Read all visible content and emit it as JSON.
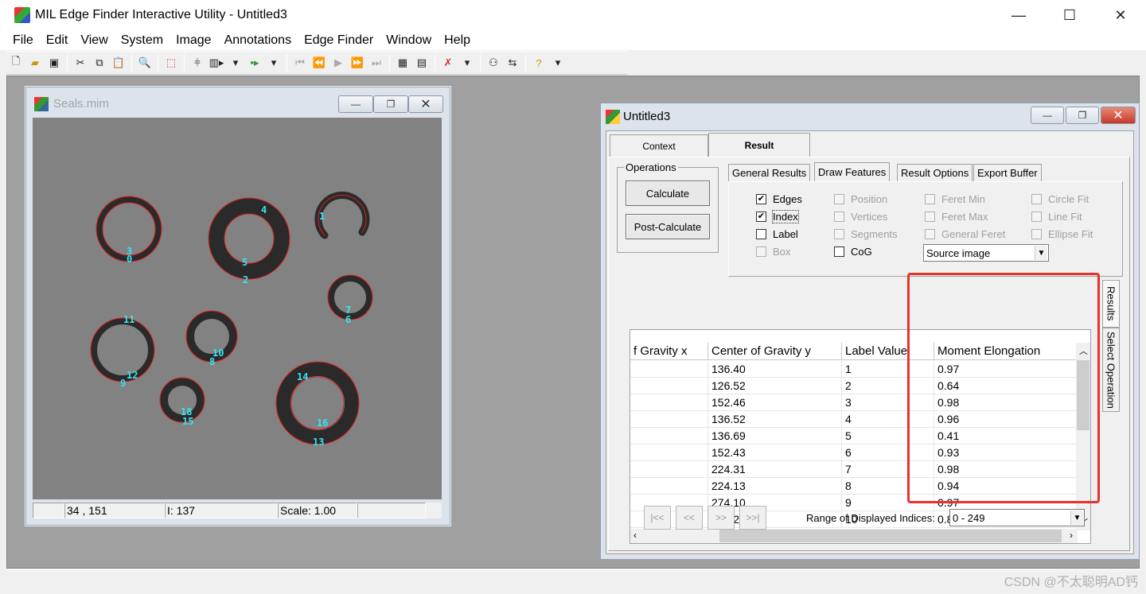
{
  "app": {
    "title": "MIL Edge Finder Interactive Utility - Untitled3"
  },
  "window_controls": {
    "minimize": "—",
    "maximize": "☐",
    "close": "✕"
  },
  "menu": [
    {
      "label": "File"
    },
    {
      "label": "Edit"
    },
    {
      "label": "View"
    },
    {
      "label": "System"
    },
    {
      "label": "Image"
    },
    {
      "label": "Annotations"
    },
    {
      "label": "Edge Finder"
    },
    {
      "label": "Window"
    },
    {
      "label": "Help"
    }
  ],
  "toolbar_icons": [
    "new-icon",
    "open-icon",
    "save-icon",
    "cut-icon",
    "copy-icon",
    "paste-icon",
    "zoom-icon",
    "select-rect-icon",
    "calibrate-icon",
    "step-icon",
    "run-icon",
    "first-icon",
    "prev-icon",
    "play-icon",
    "next-icon",
    "last-icon",
    "grid-icon",
    "properties-icon",
    "draw-icon",
    "result-icon",
    "export-icon",
    "help-icon"
  ],
  "seals_window": {
    "title": "Seals.mim",
    "status": {
      "coords": "34 , 151",
      "intensity": "I: 137",
      "scale": "Scale: 1.00"
    },
    "labels": [
      {
        "text": "3"
      },
      {
        "text": "0"
      },
      {
        "text": "4"
      },
      {
        "text": "1"
      },
      {
        "text": "5"
      },
      {
        "text": "2"
      },
      {
        "text": "7"
      },
      {
        "text": "6"
      },
      {
        "text": "11"
      },
      {
        "text": "10"
      },
      {
        "text": "8"
      },
      {
        "text": "12"
      },
      {
        "text": "9"
      },
      {
        "text": "14"
      },
      {
        "text": "18"
      },
      {
        "text": "15"
      },
      {
        "text": "16"
      },
      {
        "text": "13"
      }
    ]
  },
  "untitled_window": {
    "title": "Untitled3",
    "tabs": [
      {
        "label": "Context"
      },
      {
        "label": "Result"
      }
    ],
    "operations": {
      "label": "Operations",
      "calculate": "Calculate",
      "post_calculate": "Post-Calculate"
    },
    "inner_tabs": [
      {
        "label": "General Results"
      },
      {
        "label": "Draw Features"
      },
      {
        "label": "Result Options"
      },
      {
        "label": "Export Buffer"
      }
    ],
    "features": [
      {
        "label": "Edges",
        "checked": "✔",
        "enabled": true
      },
      {
        "label": "Index",
        "checked": "✔",
        "enabled": true
      },
      {
        "label": "Label",
        "checked": "",
        "enabled": true
      },
      {
        "label": "Box",
        "checked": "",
        "enabled": false
      },
      {
        "label": "Position",
        "checked": "",
        "enabled": false
      },
      {
        "label": "Vertices",
        "checked": "",
        "enabled": false
      },
      {
        "label": "Segments",
        "checked": "",
        "enabled": false
      },
      {
        "label": "CoG",
        "checked": "",
        "enabled": true
      },
      {
        "label": "Feret Min",
        "checked": "",
        "enabled": false
      },
      {
        "label": "Feret Max",
        "checked": "",
        "enabled": false
      },
      {
        "label": "General Feret",
        "checked": "",
        "enabled": false
      },
      {
        "label": "Circle Fit",
        "checked": "",
        "enabled": false
      },
      {
        "label": "Line Fit",
        "checked": "",
        "enabled": false
      },
      {
        "label": "Ellipse Fit",
        "checked": "",
        "enabled": false
      }
    ],
    "source_select": {
      "value": "Source image"
    },
    "grid": {
      "columns": [
        "f Gravity x",
        "Center of Gravity y",
        "Label Value",
        "Moment Elongation"
      ],
      "rows": [
        [
          "",
          "136.40",
          "1",
          "0.97"
        ],
        [
          "",
          "126.52",
          "2",
          "0.64"
        ],
        [
          "",
          "152.46",
          "3",
          "0.98"
        ],
        [
          "",
          "136.52",
          "4",
          "0.96"
        ],
        [
          "",
          "136.69",
          "5",
          "0.41"
        ],
        [
          "",
          "152.43",
          "6",
          "0.93"
        ],
        [
          "",
          "224.31",
          "7",
          "0.98"
        ],
        [
          "",
          "224.13",
          "8",
          "0.94"
        ],
        [
          "",
          "274.10",
          "9",
          "0.97"
        ],
        [
          "",
          "291.27",
          "10",
          "0.89"
        ]
      ]
    },
    "nav_buttons": [
      "|<<",
      "<<",
      ">>",
      ">>|"
    ],
    "range_label": "Range of Displayed Indices:",
    "range_value": "0 - 249",
    "side_tabs": [
      {
        "label": "Results"
      },
      {
        "label": "Select Operation"
      }
    ]
  },
  "watermark": "CSDN @不太聪明AD钙",
  "colors": {
    "highlight": "#e8322e",
    "label_cyan": "#33e6f0",
    "edge_red": "#e02020"
  }
}
